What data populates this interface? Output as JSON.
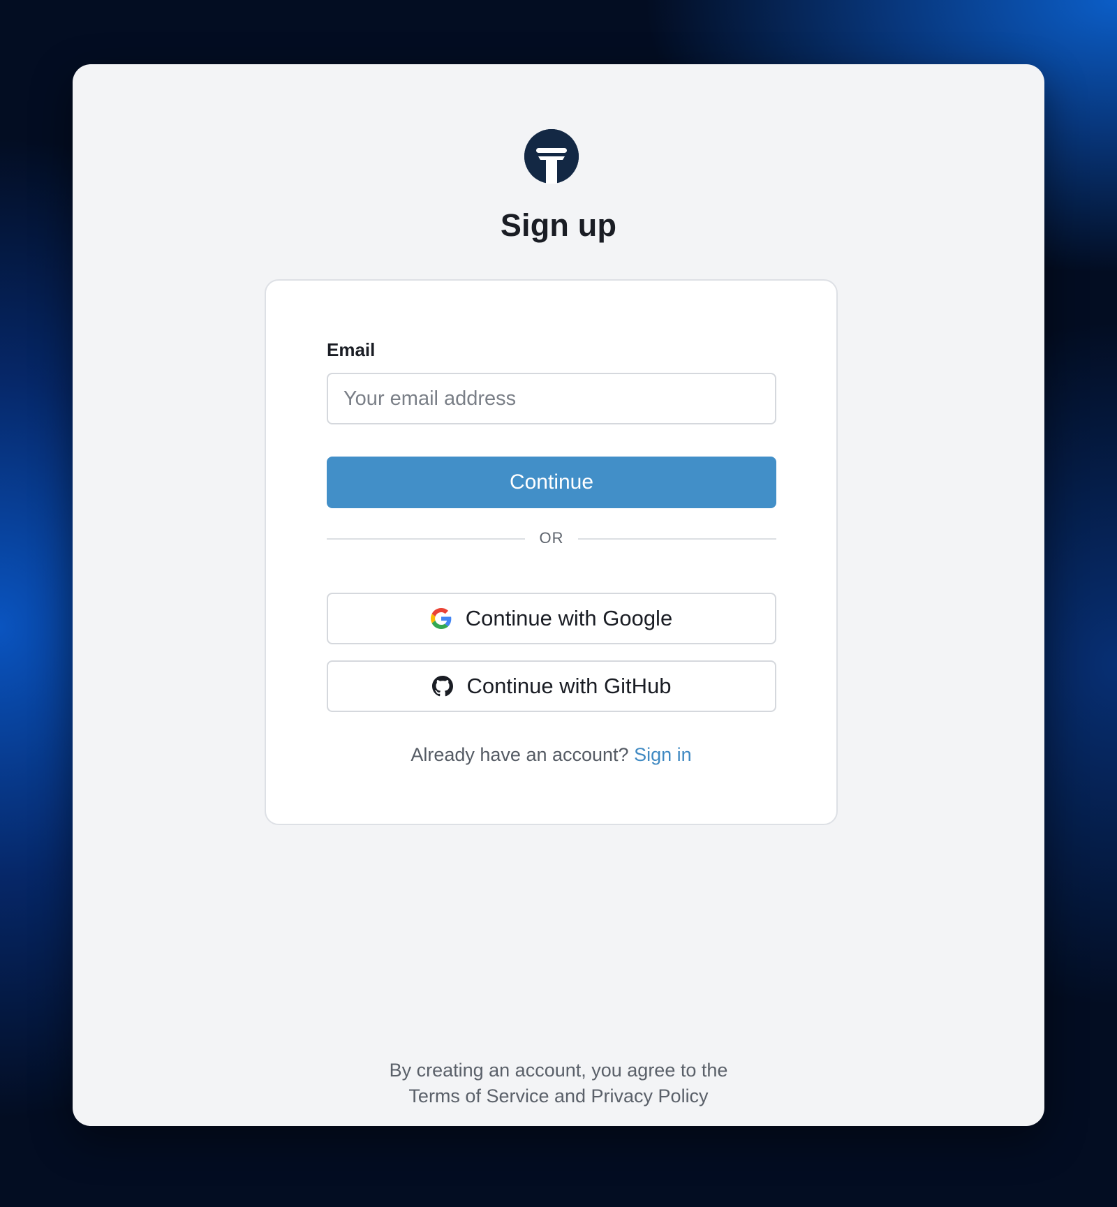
{
  "page": {
    "title": "Sign up"
  },
  "logo": {
    "icon": "brand-logo-icon",
    "color": "#132844"
  },
  "form": {
    "email_label": "Email",
    "email_placeholder": "Your email address",
    "email_value": "",
    "continue_label": "Continue",
    "continue_color": "#428fc8",
    "divider_text": "OR",
    "google_label": "Continue with Google",
    "google_icon": "google-icon",
    "github_label": "Continue with GitHub",
    "github_icon": "github-icon",
    "signin_prompt": "Already have an account?",
    "signin_link": "Sign in",
    "link_color": "#3f89c2"
  },
  "footer": {
    "line1": "By creating an account, you agree to the",
    "line2": "Terms of Service and Privacy Policy"
  }
}
